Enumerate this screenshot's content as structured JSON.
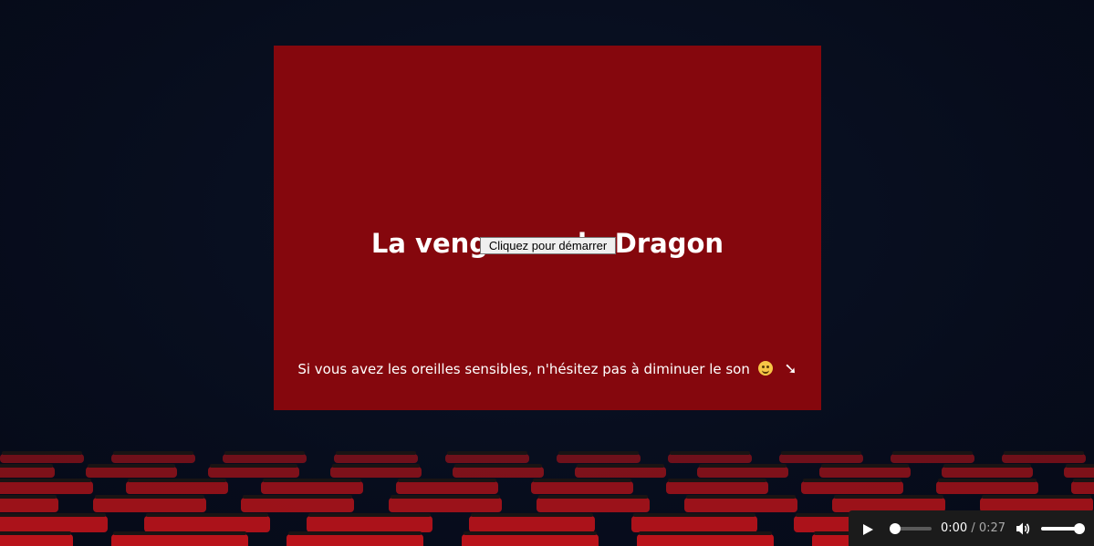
{
  "screen": {
    "title": "La vengence du Dragon",
    "start_button_label": "Cliquez pour démarrer",
    "hint_text": "Si vous avez les oreilles sensibles, n'hésitez pas à diminuer le son",
    "hint_emoji_icon": "winking-face-icon",
    "hint_arrow": "➘",
    "background_color": "#85070d"
  },
  "background": {
    "image": "theater-seats",
    "seat_color": "#c4141a"
  },
  "audio_player": {
    "play_icon": "play-icon",
    "current_time": "0:00",
    "separator": "/",
    "duration": "0:27",
    "progress": 0,
    "volume_icon": "volume-icon",
    "volume_level": 1
  }
}
